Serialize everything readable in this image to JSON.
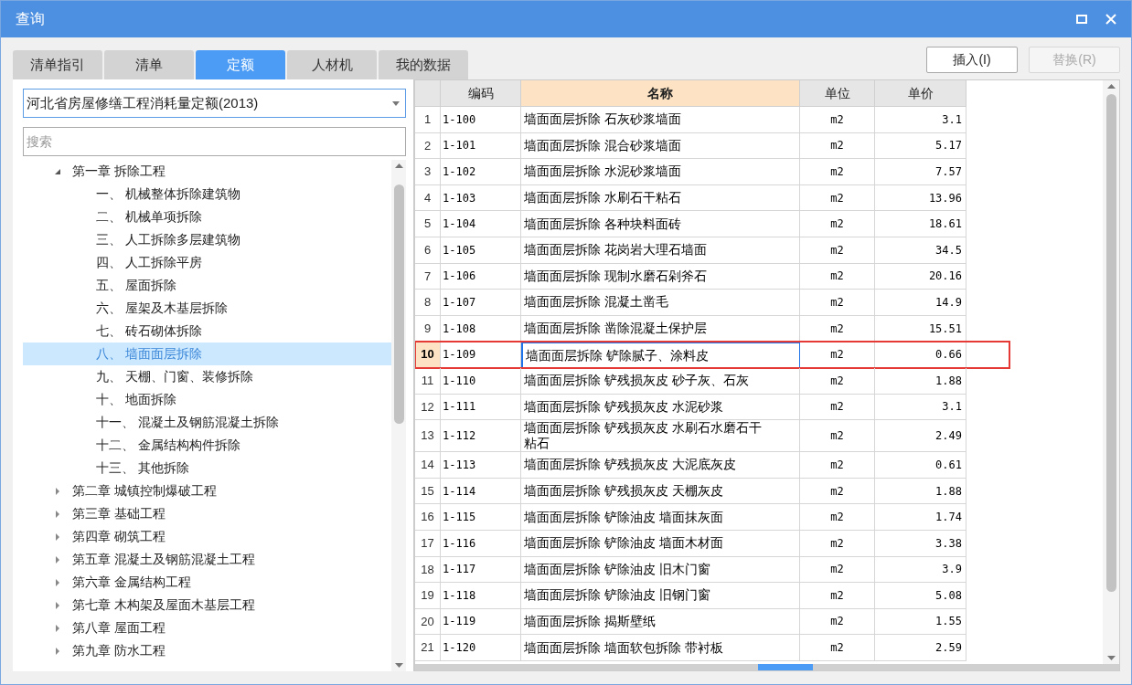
{
  "window": {
    "title": "查询"
  },
  "tabs": [
    {
      "label": "清单指引",
      "selected": false
    },
    {
      "label": "清单",
      "selected": false
    },
    {
      "label": "定额",
      "selected": true
    },
    {
      "label": "人材机",
      "selected": false
    },
    {
      "label": "我的数据",
      "selected": false
    }
  ],
  "buttons": [
    {
      "label": "插入(I)",
      "disabled": false
    },
    {
      "label": "替换(R)",
      "disabled": true
    }
  ],
  "library_select": {
    "value": "河北省房屋修缮工程消耗量定额(2013)"
  },
  "search": {
    "placeholder": "搜索"
  },
  "tree": [
    {
      "label": "第一章 拆除工程",
      "expanded": true,
      "selected": false,
      "children": [
        {
          "label": "一、 机械整体拆除建筑物",
          "selected": false
        },
        {
          "label": "二、 机械单项拆除",
          "selected": false
        },
        {
          "label": "三、 人工拆除多层建筑物",
          "selected": false
        },
        {
          "label": "四、 人工拆除平房",
          "selected": false
        },
        {
          "label": "五、 屋面拆除",
          "selected": false
        },
        {
          "label": "六、 屋架及木基层拆除",
          "selected": false
        },
        {
          "label": "七、 砖石砌体拆除",
          "selected": false
        },
        {
          "label": "八、 墙面面层拆除",
          "selected": true
        },
        {
          "label": "九、 天棚、门窗、装修拆除",
          "selected": false
        },
        {
          "label": "十、 地面拆除",
          "selected": false
        },
        {
          "label": "十一、 混凝土及钢筋混凝土拆除",
          "selected": false
        },
        {
          "label": "十二、 金属结构构件拆除",
          "selected": false
        },
        {
          "label": "十三、 其他拆除",
          "selected": false
        }
      ]
    },
    {
      "label": "第二章 城镇控制爆破工程",
      "expanded": false,
      "selected": false
    },
    {
      "label": "第三章 基础工程",
      "expanded": false,
      "selected": false
    },
    {
      "label": "第四章 砌筑工程",
      "expanded": false,
      "selected": false
    },
    {
      "label": "第五章 混凝土及钢筋混凝土工程",
      "expanded": false,
      "selected": false
    },
    {
      "label": "第六章 金属结构工程",
      "expanded": false,
      "selected": false
    },
    {
      "label": "第七章 木构架及屋面木基层工程",
      "expanded": false,
      "selected": false
    },
    {
      "label": "第八章 屋面工程",
      "expanded": false,
      "selected": false
    },
    {
      "label": "第九章 防水工程",
      "expanded": false,
      "selected": false
    }
  ],
  "table": {
    "columns": [
      {
        "label": "编码",
        "selected": false
      },
      {
        "label": "名称",
        "selected": true
      },
      {
        "label": "单位",
        "selected": false
      },
      {
        "label": "单价",
        "selected": false
      }
    ],
    "rows": [
      {
        "index": "1",
        "code": "1-100",
        "name": "墙面面层拆除 石灰砂浆墙面",
        "unit": "m2",
        "price": "3.1",
        "selected": false
      },
      {
        "index": "2",
        "code": "1-101",
        "name": "墙面面层拆除 混合砂浆墙面",
        "unit": "m2",
        "price": "5.17",
        "selected": false
      },
      {
        "index": "3",
        "code": "1-102",
        "name": "墙面面层拆除 水泥砂浆墙面",
        "unit": "m2",
        "price": "7.57",
        "selected": false
      },
      {
        "index": "4",
        "code": "1-103",
        "name": "墙面面层拆除 水刷石干粘石",
        "unit": "m2",
        "price": "13.96",
        "selected": false
      },
      {
        "index": "5",
        "code": "1-104",
        "name": "墙面面层拆除 各种块料面砖",
        "unit": "m2",
        "price": "18.61",
        "selected": false
      },
      {
        "index": "6",
        "code": "1-105",
        "name": "墙面面层拆除 花岗岩大理石墙面",
        "unit": "m2",
        "price": "34.5",
        "selected": false
      },
      {
        "index": "7",
        "code": "1-106",
        "name": "墙面面层拆除 现制水磨石剁斧石",
        "unit": "m2",
        "price": "20.16",
        "selected": false
      },
      {
        "index": "8",
        "code": "1-107",
        "name": "墙面面层拆除 混凝土凿毛",
        "unit": "m2",
        "price": "14.9",
        "selected": false
      },
      {
        "index": "9",
        "code": "1-108",
        "name": "墙面面层拆除 凿除混凝土保护层",
        "unit": "m2",
        "price": "15.51",
        "selected": false
      },
      {
        "index": "10",
        "code": "1-109",
        "name": "墙面面层拆除 铲除腻子、涂料皮",
        "unit": "m2",
        "price": "0.66",
        "selected": true
      },
      {
        "index": "11",
        "code": "1-110",
        "name": "墙面面层拆除 铲残损灰皮 砂子灰、石灰",
        "unit": "m2",
        "price": "1.88",
        "selected": false
      },
      {
        "index": "12",
        "code": "1-111",
        "name": "墙面面层拆除 铲残损灰皮 水泥砂浆",
        "unit": "m2",
        "price": "3.1",
        "selected": false
      },
      {
        "index": "13",
        "code": "1-112",
        "name": "墙面面层拆除 铲残损灰皮 水刷石水磨石干粘石",
        "unit": "m2",
        "price": "2.49",
        "selected": false
      },
      {
        "index": "14",
        "code": "1-113",
        "name": "墙面面层拆除 铲残损灰皮 大泥底灰皮",
        "unit": "m2",
        "price": "0.61",
        "selected": false
      },
      {
        "index": "15",
        "code": "1-114",
        "name": "墙面面层拆除 铲残损灰皮 天棚灰皮",
        "unit": "m2",
        "price": "1.88",
        "selected": false
      },
      {
        "index": "16",
        "code": "1-115",
        "name": "墙面面层拆除 铲除油皮 墙面抹灰面",
        "unit": "m2",
        "price": "1.74",
        "selected": false
      },
      {
        "index": "17",
        "code": "1-116",
        "name": "墙面面层拆除 铲除油皮 墙面木材面",
        "unit": "m2",
        "price": "3.38",
        "selected": false
      },
      {
        "index": "18",
        "code": "1-117",
        "name": "墙面面层拆除 铲除油皮 旧木门窗",
        "unit": "m2",
        "price": "3.9",
        "selected": false
      },
      {
        "index": "19",
        "code": "1-118",
        "name": "墙面面层拆除 铲除油皮 旧钢门窗",
        "unit": "m2",
        "price": "5.08",
        "selected": false
      },
      {
        "index": "20",
        "code": "1-119",
        "name": "墙面面层拆除 揭斯壁纸",
        "unit": "m2",
        "price": "1.55",
        "selected": false
      },
      {
        "index": "21",
        "code": "1-120",
        "name": "墙面面层拆除 墙面软包拆除 带衬板",
        "unit": "m2",
        "price": "2.59",
        "selected": false
      }
    ]
  }
}
